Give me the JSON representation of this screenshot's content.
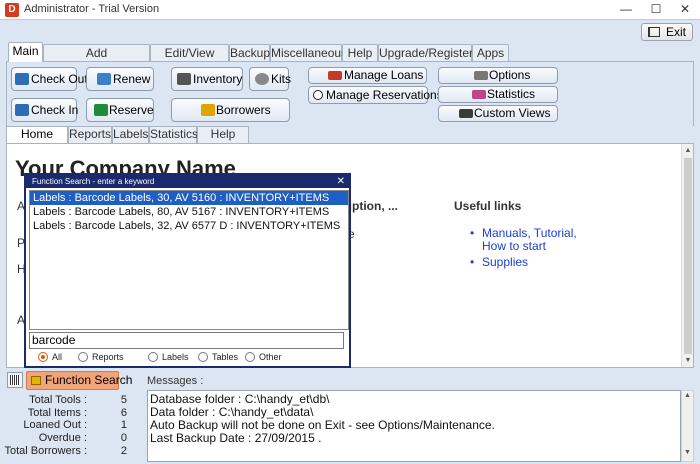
{
  "window": {
    "title": "Administrator - Trial Version",
    "app_icon": "D",
    "minimize": "—",
    "maximize": "☐",
    "close": "✕"
  },
  "toolbar": {
    "exit_label": "Exit"
  },
  "main_tabs": [
    "Main",
    "Add Items/Borrowers",
    "Edit/View Table",
    "Backup",
    "Miscellaneous",
    "Help",
    "Upgrade/Register",
    "Apps"
  ],
  "buttons": {
    "check_out": "Check Out",
    "check_in": "Check In",
    "renew": "Renew",
    "reserve": "Reserve",
    "inventory": "Inventory",
    "kits": "Kits",
    "borrowers": "Borrowers",
    "manage_loans": "Manage Loans",
    "manage_reservations": "Manage Reservations",
    "options": "Options",
    "statistics": "Statistics",
    "custom_views": "Custom Views"
  },
  "sub_tabs": [
    "Home Page",
    "Reports",
    "Labels",
    "Statistics",
    "Help Links"
  ],
  "home": {
    "company": "Your Company Name",
    "frag_a1": "A",
    "frag_p": "P",
    "frag_h": "H",
    "frag_a2": "A",
    "frag_ription": "ription, ...",
    "frag_re": "re",
    "useful_title": "Useful links",
    "links": [
      "Manuals, Tutorial, How to start",
      "Supplies"
    ]
  },
  "function_search": {
    "title": "Function Search - enter a keyword",
    "close": "✕",
    "results": [
      "Labels : Barcode Labels, 30, AV 5160 : INVENTORY+ITEMS",
      "Labels : Barcode Labels, 80, AV 5167 : INVENTORY+ITEMS",
      "Labels : Barcode Labels, 32, AV 6577 D : INVENTORY+ITEMS"
    ],
    "query": "barcode",
    "filters": [
      "All",
      "Reports",
      "Labels",
      "Tables",
      "Other"
    ]
  },
  "bottom": {
    "function_search_label": "Function Search",
    "messages_label": "Messages :",
    "stats": [
      {
        "label": "Total Tools :",
        "value": "5"
      },
      {
        "label": "Total Items :",
        "value": "6"
      },
      {
        "label": "Loaned Out :",
        "value": "1"
      },
      {
        "label": "Overdue :",
        "value": "0"
      },
      {
        "label": "Total Borrowers :",
        "value": "2"
      }
    ],
    "messages": [
      "Database folder : C:\\handy_et\\db\\",
      "Data folder : C:\\handy_et\\data\\",
      "Auto Backup will not be done on Exit - see Options/Maintenance.",
      "Last Backup Date : 27/09/2015 ."
    ]
  }
}
